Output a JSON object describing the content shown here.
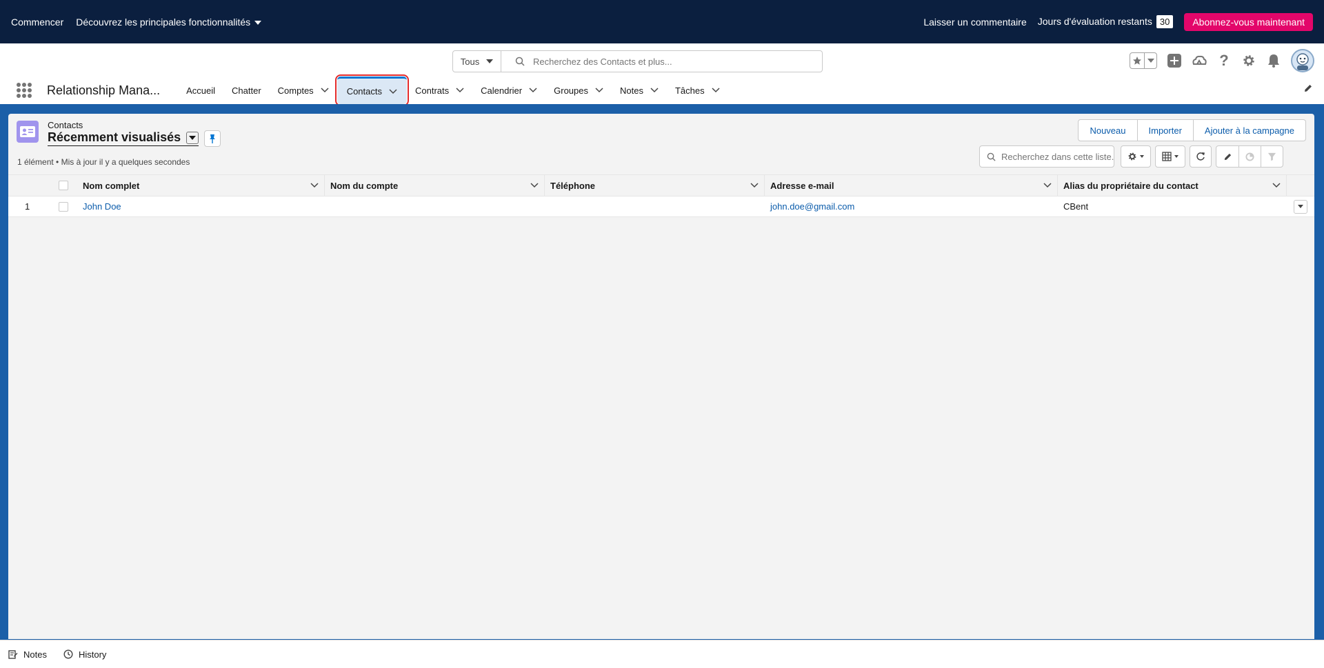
{
  "trial_bar": {
    "get_started": "Commencer",
    "discover": "Découvrez les principales fonctionnalités",
    "feedback": "Laisser un commentaire",
    "days_left_label": "Jours d'évaluation restants",
    "days_left_value": "30",
    "subscribe": "Abonnez-vous maintenant"
  },
  "global_header": {
    "scope": "Tous",
    "search_placeholder": "Recherchez des Contacts et plus..."
  },
  "app": {
    "name": "Relationship Mana...",
    "nav": [
      {
        "label": "Accueil",
        "dropdown": false
      },
      {
        "label": "Chatter",
        "dropdown": false
      },
      {
        "label": "Comptes",
        "dropdown": true
      },
      {
        "label": "Contacts",
        "dropdown": true,
        "active": true
      },
      {
        "label": "Contrats",
        "dropdown": true
      },
      {
        "label": "Calendrier",
        "dropdown": true
      },
      {
        "label": "Groupes",
        "dropdown": true
      },
      {
        "label": "Notes",
        "dropdown": true
      },
      {
        "label": "Tâches",
        "dropdown": true
      }
    ]
  },
  "list_view": {
    "object_label": "Contacts",
    "view_name": "Récemment visualisés",
    "buttons": {
      "new": "Nouveau",
      "import": "Importer",
      "add_to_campaign": "Ajouter à la campagne"
    },
    "meta": "1 élément • Mis à jour il y a quelques secondes",
    "search_placeholder": "Recherchez dans cette liste...",
    "columns": {
      "name": "Nom complet",
      "account": "Nom du compte",
      "phone": "Téléphone",
      "email": "Adresse e-mail",
      "owner": "Alias du propriétaire du contact"
    },
    "rows": [
      {
        "num": "1",
        "name": "John Doe",
        "account": "",
        "phone": "",
        "email": "john.doe@gmail.com",
        "owner": "CBent"
      }
    ]
  },
  "utility_bar": {
    "notes": "Notes",
    "history": "History"
  },
  "colors": {
    "trial_bg": "#0b1f3f",
    "subscribe": "#e3066a",
    "brand_blue": "#0176d3",
    "band": "#1b5fa8",
    "contact_icon": "#a094ed",
    "highlight": "#e32b2b"
  }
}
